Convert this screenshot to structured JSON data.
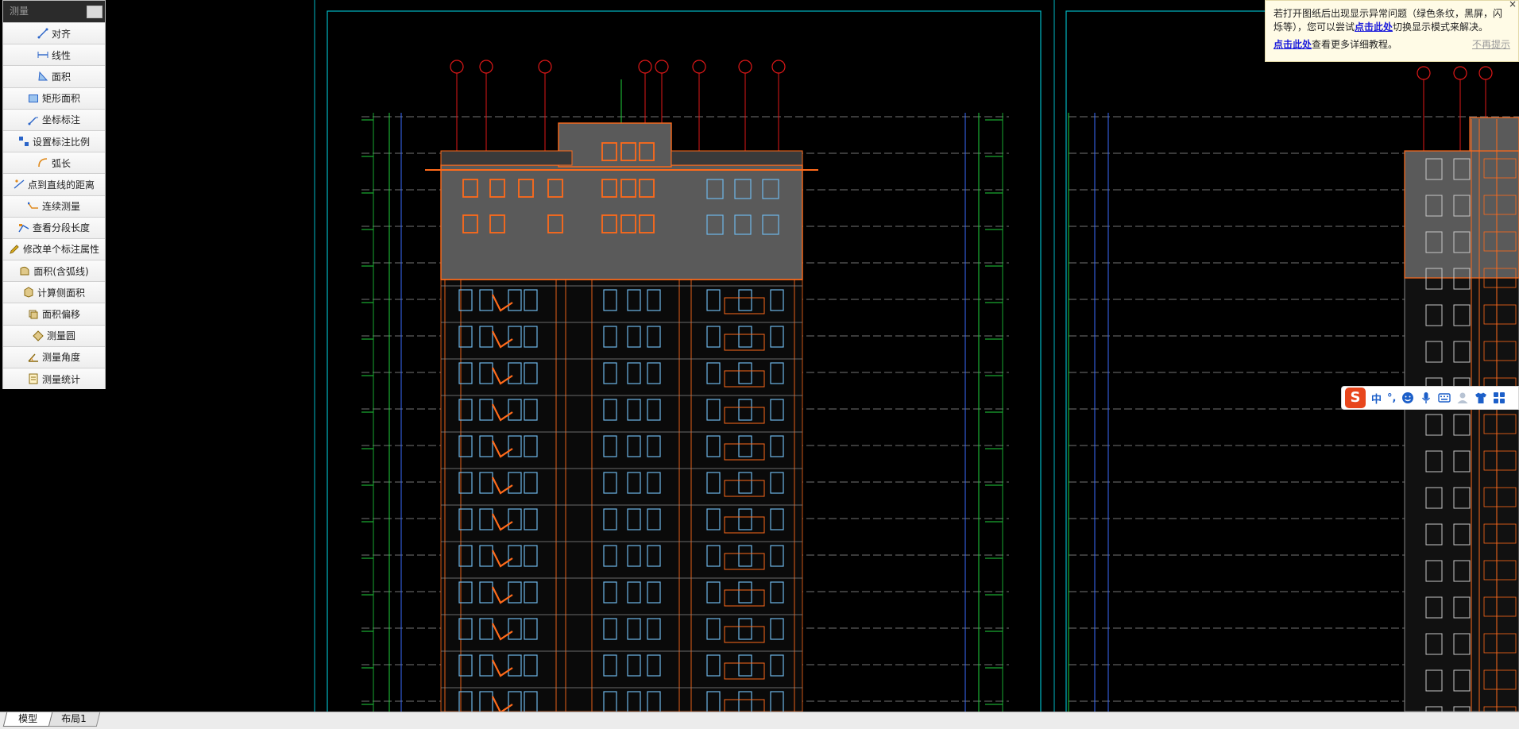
{
  "measure_panel": {
    "title": "测量",
    "items": [
      {
        "label": "对齐",
        "icon": "align-dimension-icon"
      },
      {
        "label": "线性",
        "icon": "linear-dimension-icon"
      },
      {
        "label": "面积",
        "icon": "area-icon"
      },
      {
        "label": "矩形面积",
        "icon": "rectangle-area-icon"
      },
      {
        "label": "坐标标注",
        "icon": "coordinate-icon"
      },
      {
        "label": "设置标注比例",
        "icon": "scale-icon"
      },
      {
        "label": "弧长",
        "icon": "arc-length-icon"
      },
      {
        "label": "点到直线的距离",
        "icon": "point-line-distance-icon"
      },
      {
        "label": "连续测量",
        "icon": "continuous-measure-icon"
      },
      {
        "label": "查看分段长度",
        "icon": "segment-length-icon"
      },
      {
        "label": "修改单个标注属性",
        "icon": "edit-dimension-icon"
      },
      {
        "label": "面积(含弧线)",
        "icon": "arc-area-icon"
      },
      {
        "label": "计算侧面积",
        "icon": "side-area-icon"
      },
      {
        "label": "面积偏移",
        "icon": "area-offset-icon"
      },
      {
        "label": "测量圆",
        "icon": "circle-measure-icon"
      },
      {
        "label": "测量角度",
        "icon": "angle-icon"
      },
      {
        "label": "测量统计",
        "icon": "statistics-icon"
      }
    ]
  },
  "notice": {
    "line1": "若打开图纸后出现显示异常问题（绿色条纹，黑屏，闪",
    "line2_prefix": "烁等），您可以尝试",
    "line2_link": "点击此处",
    "line2_suffix": "切换显示模式来解决。",
    "row2_link": "点击此处",
    "row2_text": "查看更多详细教程。",
    "dismiss": "不再提示",
    "close": "×"
  },
  "ime": {
    "logo": "S",
    "mode": "中",
    "punct": "°,"
  },
  "tabs": {
    "model": "模型",
    "layout1": "布局1"
  },
  "colors": {
    "background": "#000000",
    "frame": "#00b7c3",
    "facade": "#ff6a1a",
    "window": "#6fb7e8",
    "gridline_green": "#1fd23b",
    "gridline_blue": "#3a6cff",
    "axis_red": "#e01818",
    "level_line": "#9a9a9a"
  }
}
